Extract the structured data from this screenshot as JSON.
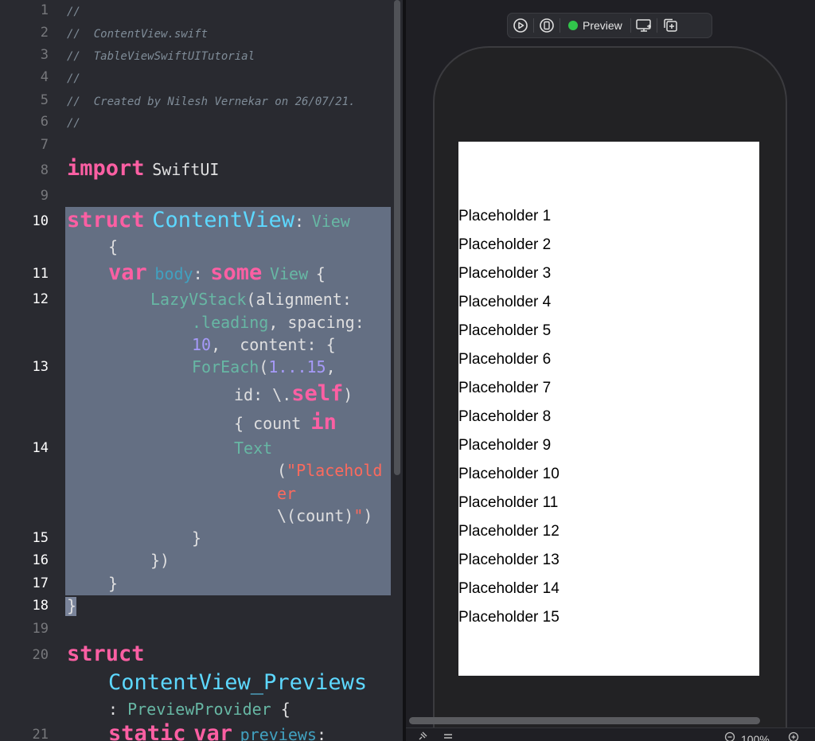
{
  "editor": {
    "line_numbers": [
      "1",
      "2",
      "3",
      "4",
      "5",
      "6",
      "7",
      "8",
      "9",
      "10",
      "11",
      "12",
      "13",
      "14",
      "15",
      "16",
      "17",
      "18",
      "19",
      "20",
      "21"
    ],
    "comments": [
      "//",
      "//  ContentView.swift",
      "//  TableViewSwiftUITutorial",
      "//",
      "//  Created by Nilesh Vernekar on 26/07/21.",
      "//"
    ],
    "code": {
      "import_kw": "import",
      "import_mod": "SwiftUI",
      "struct_kw": "struct",
      "content_view": "ContentView",
      "colon_view_punct": ":",
      "view_type": "View",
      "open_brace": "{",
      "var_kw": "var",
      "body": "body",
      "colon": ":",
      "some_kw": "some",
      "view_type2": "View",
      "brace2": "{",
      "lazyvstack": "LazyVStack",
      "alignment": "(alignment:",
      "leading": ".leading",
      "spacing": ", spacing:",
      "ten": "10",
      "content": ",  content: {",
      "foreach": "ForEach",
      "range_open": "(",
      "range": "1...15",
      "range_comma": ",",
      "id": "id: \\.",
      "self_kw": "self",
      "paren_close": ")",
      "count_open": "{ count",
      "in_kw": "in",
      "text_fn": "Text",
      "str_open": "(",
      "str1": "\"Placehold",
      "str2": "er",
      "interp": "\\(count)",
      "str_end": "\"",
      "paren_end": ")",
      "close15": "}",
      "close16": "})",
      "close17": "}",
      "close18": "}",
      "struct_kw2": "struct",
      "previews_name": "ContentView_Previews",
      "colon_pp": ":",
      "preview_provider": "PreviewProvider",
      "brace_pp": "{",
      "static_kw": "static",
      "var_kw2": "var",
      "previews": "previews",
      "colon_end": ":"
    }
  },
  "canvas": {
    "toolbar": {
      "icons": [
        "play-circle-icon",
        "device-live-icon",
        "device-settings-icon",
        "duplicate-icon"
      ],
      "preview_label": "Preview",
      "live_color": "#31c54b"
    },
    "placeholders": [
      "Placeholder 1",
      "Placeholder 2",
      "Placeholder 3",
      "Placeholder 4",
      "Placeholder 5",
      "Placeholder 6",
      "Placeholder 7",
      "Placeholder 8",
      "Placeholder 9",
      "Placeholder 10",
      "Placeholder 11",
      "Placeholder 12",
      "Placeholder 13",
      "Placeholder 14",
      "Placeholder 15"
    ],
    "zoom_label": "100%"
  },
  "theme": {
    "editor_bg": "#292a30",
    "selection": "#646f83",
    "keyword": "#fc5fa3",
    "type": "#5dd8ff",
    "string": "#fc6a5d",
    "number": "#a69af9"
  }
}
